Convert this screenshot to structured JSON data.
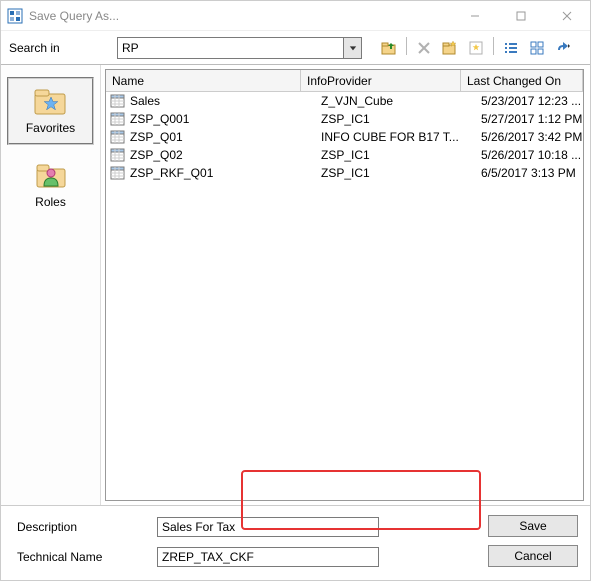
{
  "window": {
    "title": "Save Query As..."
  },
  "toolbar": {
    "search_label": "Search in",
    "combo_value": "RP"
  },
  "sidebar": {
    "items": [
      {
        "label": "Favorites"
      },
      {
        "label": "Roles"
      }
    ]
  },
  "table": {
    "cols": {
      "name": "Name",
      "info": "InfoProvider",
      "date": "Last Changed On"
    },
    "rows": [
      {
        "name": "Sales",
        "info": "Z_VJN_Cube",
        "date": "5/23/2017 12:23 ..."
      },
      {
        "name": "ZSP_Q001",
        "info": "ZSP_IC1",
        "date": "5/27/2017 1:12 PM"
      },
      {
        "name": "ZSP_Q01",
        "info": "INFO CUBE FOR B17 T...",
        "date": "5/26/2017 3:42 PM"
      },
      {
        "name": "ZSP_Q02",
        "info": "ZSP_IC1",
        "date": "5/26/2017 10:18 ..."
      },
      {
        "name": "ZSP_RKF_Q01",
        "info": "ZSP_IC1",
        "date": "6/5/2017 3:13 PM"
      }
    ]
  },
  "form": {
    "desc_label": "Description",
    "desc_value": "Sales For Tax",
    "tech_label": "Technical Name",
    "tech_value": "ZREP_TAX_CKF"
  },
  "buttons": {
    "save": "Save",
    "cancel": "Cancel"
  }
}
